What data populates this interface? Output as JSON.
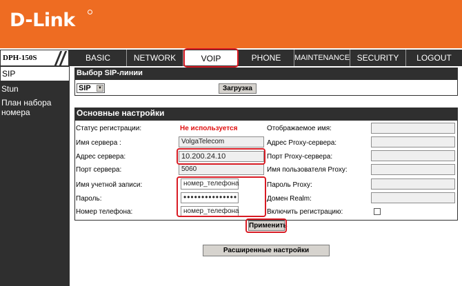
{
  "brand": {
    "logo_text": "D-Link"
  },
  "nav": {
    "model": "DPH-150S",
    "tabs": [
      "BASIC",
      "NETWORK",
      "VOIP",
      "PHONE",
      "MAINTENANCE",
      "SECURITY",
      "LOGOUT"
    ],
    "active_tab": "VOIP"
  },
  "sidebar": {
    "items": [
      "SIP",
      "Stun",
      "План набора номера"
    ],
    "active": "SIP"
  },
  "sip_line": {
    "title": "Выбор SIP-линии",
    "select_value": "SIP",
    "load_button": "Загрузка"
  },
  "basic": {
    "title": "Основные настройки",
    "left": {
      "reg_status_label": "Статус регистрации:",
      "reg_status_value": "Не используется",
      "server_name_label": "Имя сервера :",
      "server_name_value": "VolgaTelecom",
      "server_addr_label": "Адрес сервера:",
      "server_addr_value": "10.200.24.10",
      "server_port_label": "Порт сервера:",
      "server_port_value": "5060",
      "account_label": "Имя учетной записи:",
      "account_value": "номер_телефона",
      "password_label": "Пароль:",
      "password_value": "•••••••••••••••",
      "phone_label": "Номер телефона:",
      "phone_value": "номер_телефона"
    },
    "right": {
      "display_name_label": "Отображаемое имя:",
      "proxy_addr_label": "Адрес Proxy-сервера:",
      "proxy_port_label": "Порт Proxy-сервера:",
      "proxy_user_label": "Имя пользователя Proxy:",
      "proxy_password_label": "Пароль Proxy:",
      "realm_label": "Домен Realm:",
      "enable_reg_label": "Включить регистрацию:"
    },
    "apply_button": "Применить",
    "advanced_button": "Расширенные настройки"
  },
  "colors": {
    "header_orange": "#ee6c22",
    "nav_dark": "#2f2f2f",
    "highlight_red": "#d81a23",
    "status_red": "#e01010"
  }
}
